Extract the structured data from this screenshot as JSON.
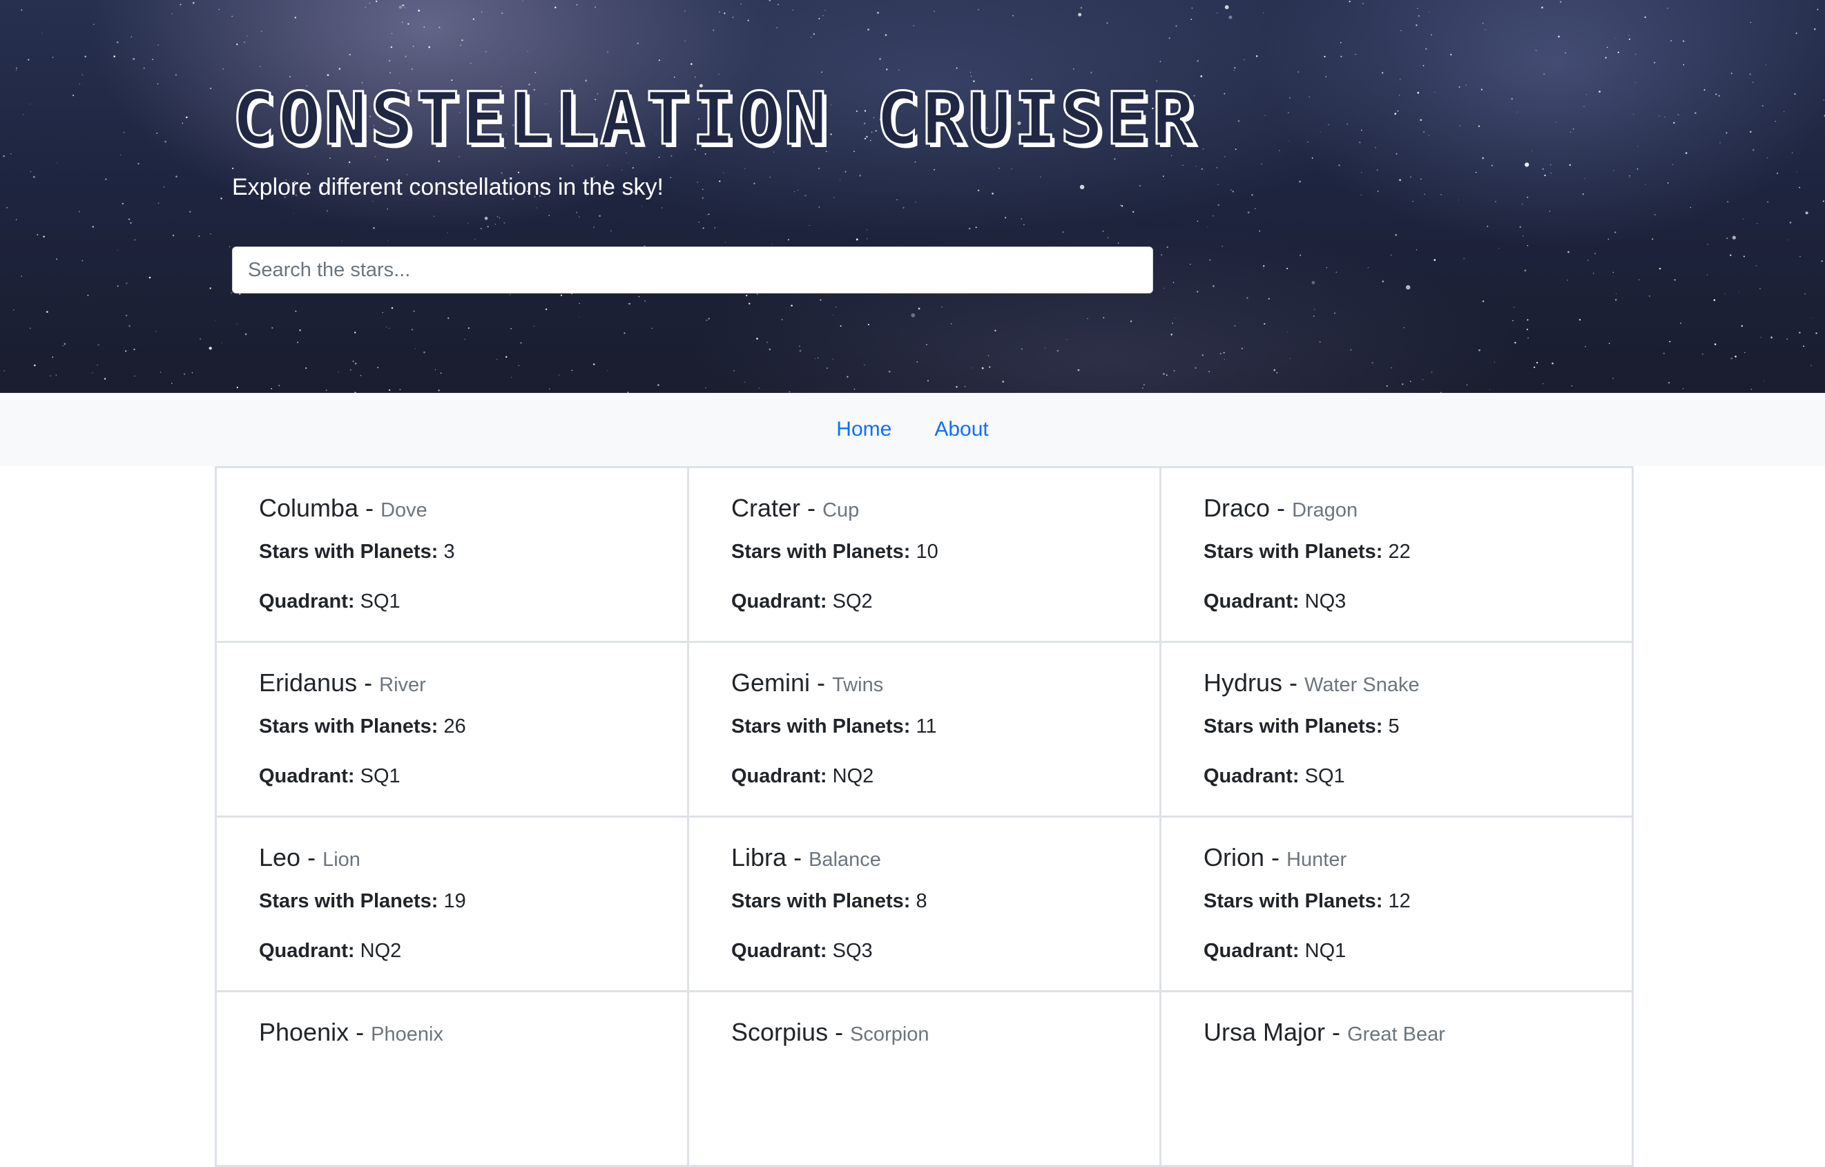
{
  "hero": {
    "title": "Constellation Cruiser",
    "subtitle": "Explore different constellations in the sky!"
  },
  "search": {
    "placeholder": "Search the stars..."
  },
  "nav": {
    "home": "Home",
    "about": "About"
  },
  "labels": {
    "stars_with_planets": "Stars with Planets:",
    "quadrant": "Quadrant:",
    "separator": "-"
  },
  "constellations": [
    {
      "name": "Columba",
      "meaning": "Dove",
      "stars_with_planets": "3",
      "quadrant": "SQ1"
    },
    {
      "name": "Crater",
      "meaning": "Cup",
      "stars_with_planets": "10",
      "quadrant": "SQ2"
    },
    {
      "name": "Draco",
      "meaning": "Dragon",
      "stars_with_planets": "22",
      "quadrant": "NQ3"
    },
    {
      "name": "Eridanus",
      "meaning": "River",
      "stars_with_planets": "26",
      "quadrant": "SQ1"
    },
    {
      "name": "Gemini",
      "meaning": "Twins",
      "stars_with_planets": "11",
      "quadrant": "NQ2"
    },
    {
      "name": "Hydrus",
      "meaning": "Water Snake",
      "stars_with_planets": "5",
      "quadrant": "SQ1"
    },
    {
      "name": "Leo",
      "meaning": "Lion",
      "stars_with_planets": "19",
      "quadrant": "NQ2"
    },
    {
      "name": "Libra",
      "meaning": "Balance",
      "stars_with_planets": "8",
      "quadrant": "SQ3"
    },
    {
      "name": "Orion",
      "meaning": "Hunter",
      "stars_with_planets": "12",
      "quadrant": "NQ1"
    },
    {
      "name": "Phoenix",
      "meaning": "Phoenix"
    },
    {
      "name": "Scorpius",
      "meaning": "Scorpion"
    },
    {
      "name": "Ursa Major",
      "meaning": "Great Bear"
    }
  ]
}
